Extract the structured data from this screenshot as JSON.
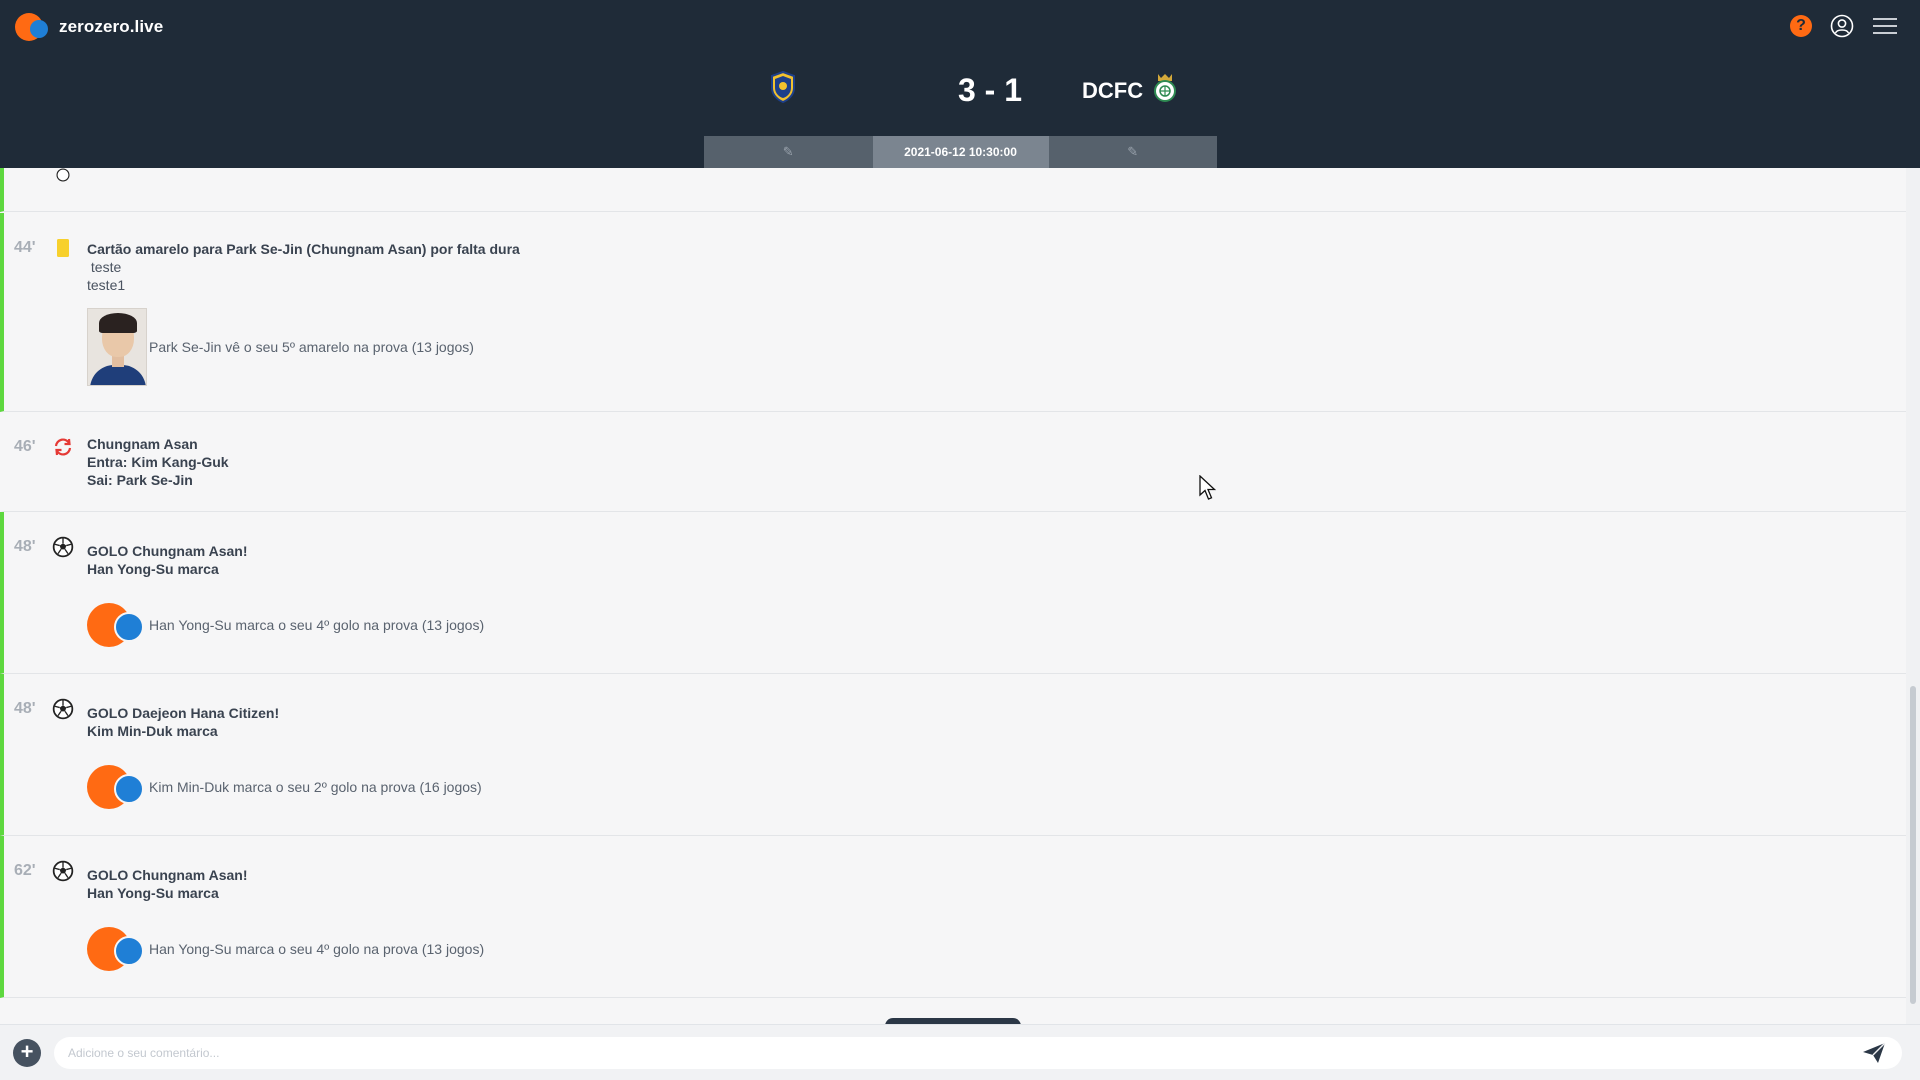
{
  "header": {
    "logo_text": "zerozero.live",
    "help_label": "?",
    "brand_colors": {
      "orange": "#ff6a13",
      "blue": "#1f7fd6",
      "navy": "#1f2b38",
      "green": "#5ed83f"
    }
  },
  "match": {
    "score": "3 - 1",
    "away_team": "DCFC",
    "datetime": "2021-06-12 10:30:00",
    "home_crest_icon": "chungnam-asan-crest-icon",
    "away_crest_icon": "daejeon-crest-icon"
  },
  "events": [
    {
      "minute": "44'",
      "icon": "yellow-card-icon",
      "title": "Cartão amarelo para Park Se-Jin (Chungnam Asan) por falta dura",
      "lines": [
        " teste",
        "teste1"
      ],
      "stat": "Park Se-Jin vê o seu 5º amarelo na prova (13 jogos)"
    },
    {
      "minute": "46'",
      "icon": "substitution-icon",
      "title": "Chungnam Asan",
      "lines": [
        "Entra: Kim Kang-Guk",
        "Sai: Park Se-Jin"
      ]
    },
    {
      "minute": "48'",
      "icon": "goal-ball-icon",
      "title": "GOLO Chungnam Asan!",
      "lines": [
        "Han Yong-Su marca"
      ],
      "stat": "Han Yong-Su marca o seu 4º golo na prova (13 jogos)"
    },
    {
      "minute": "48'",
      "icon": "goal-ball-icon",
      "title": "GOLO Daejeon Hana Citizen!",
      "lines": [
        "Kim Min-Duk marca"
      ],
      "stat": "Kim Min-Duk marca o seu 2º golo na prova (16 jogos)"
    },
    {
      "minute": "62'",
      "icon": "goal-ball-icon",
      "title": "GOLO Chungnam Asan!",
      "lines": [
        "Han Yong-Su marca"
      ],
      "stat": "Han Yong-Su marca o seu 4º golo na prova (13 jogos)"
    }
  ],
  "comment": {
    "placeholder": "Adicione o seu comentário..."
  }
}
